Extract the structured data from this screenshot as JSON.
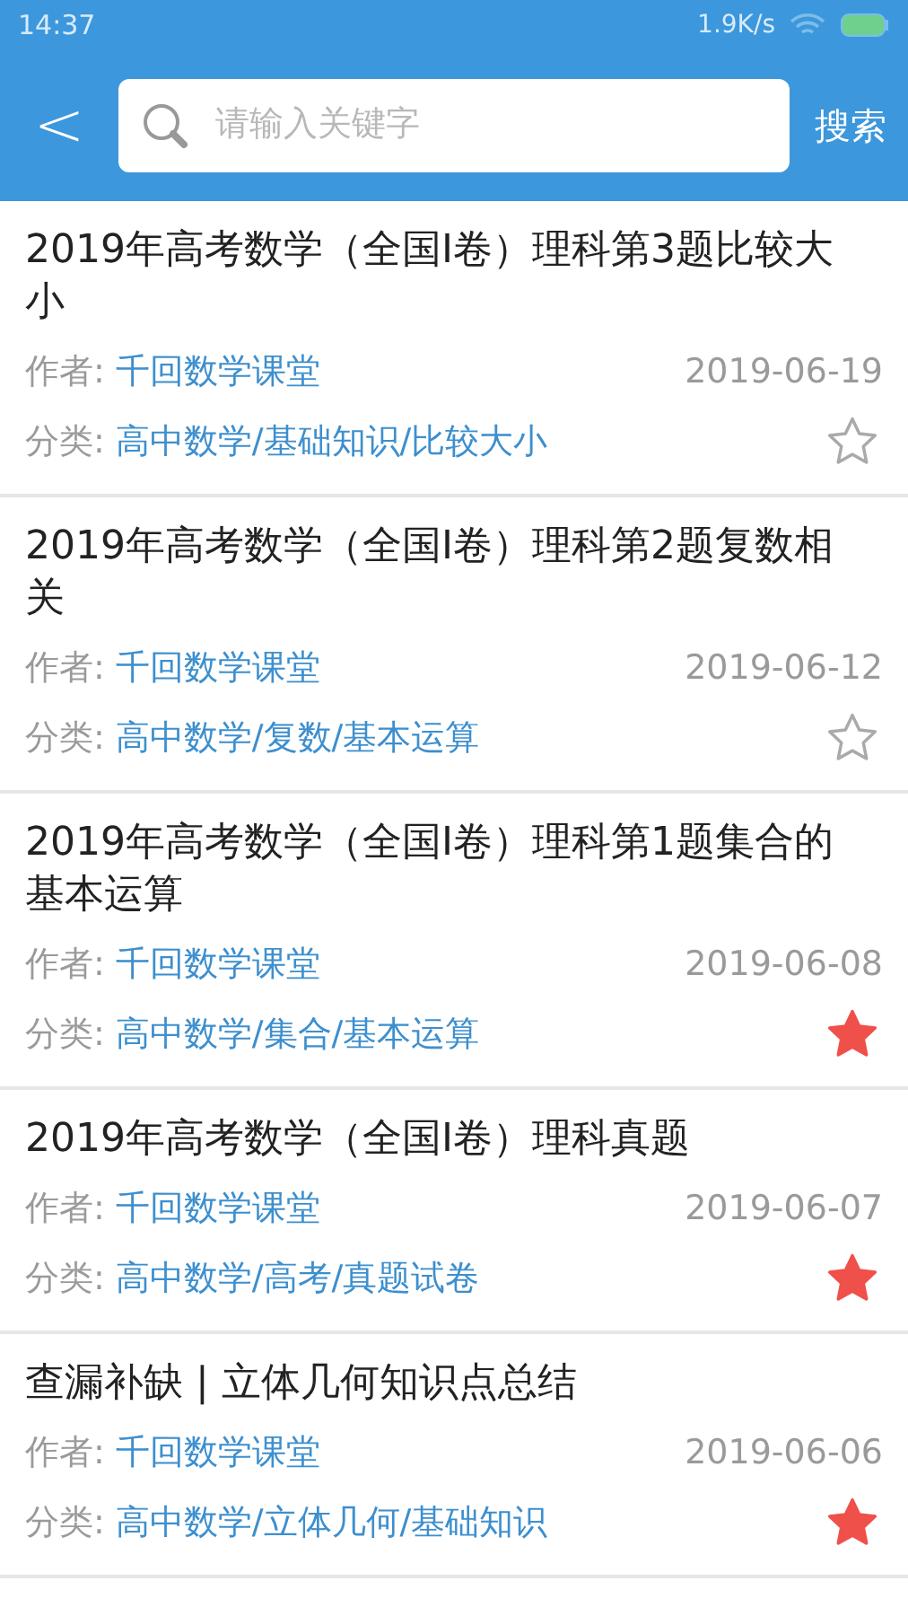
{
  "status_bar": {
    "time": "14:37",
    "speed": "1.9K/s"
  },
  "header": {
    "back": "<",
    "search": {
      "placeholder": "请输入关键字"
    },
    "search_button": "搜索"
  },
  "articles": [
    {
      "title": "2019年高考数学（全国I卷）理科第3题比较大小",
      "author_label": "作者:",
      "author": "千回数学课堂",
      "date": "2019-06-19",
      "category_label": "分类:",
      "category": "高中数学/基础知识/比较大小",
      "starred": false
    },
    {
      "title": "2019年高考数学（全国I卷）理科第2题复数相关",
      "author_label": "作者:",
      "author": "千回数学课堂",
      "date": "2019-06-12",
      "category_label": "分类:",
      "category": "高中数学/复数/基本运算",
      "starred": false
    },
    {
      "title": "2019年高考数学（全国I卷）理科第1题集合的基本运算",
      "author_label": "作者:",
      "author": "千回数学课堂",
      "date": "2019-06-08",
      "category_label": "分类:",
      "category": "高中数学/集合/基本运算",
      "starred": true
    },
    {
      "title": "2019年高考数学（全国I卷）理科真题",
      "author_label": "作者:",
      "author": "千回数学课堂",
      "date": "2019-06-07",
      "category_label": "分类:",
      "category": "高中数学/高考/真题试卷",
      "starred": true
    },
    {
      "title": "查漏补缺 | 立体几何知识点总结",
      "author_label": "作者:",
      "author": "千回数学课堂",
      "date": "2019-06-06",
      "category_label": "分类:",
      "category": "高中数学/立体几何/基础知识",
      "starred": true
    }
  ]
}
